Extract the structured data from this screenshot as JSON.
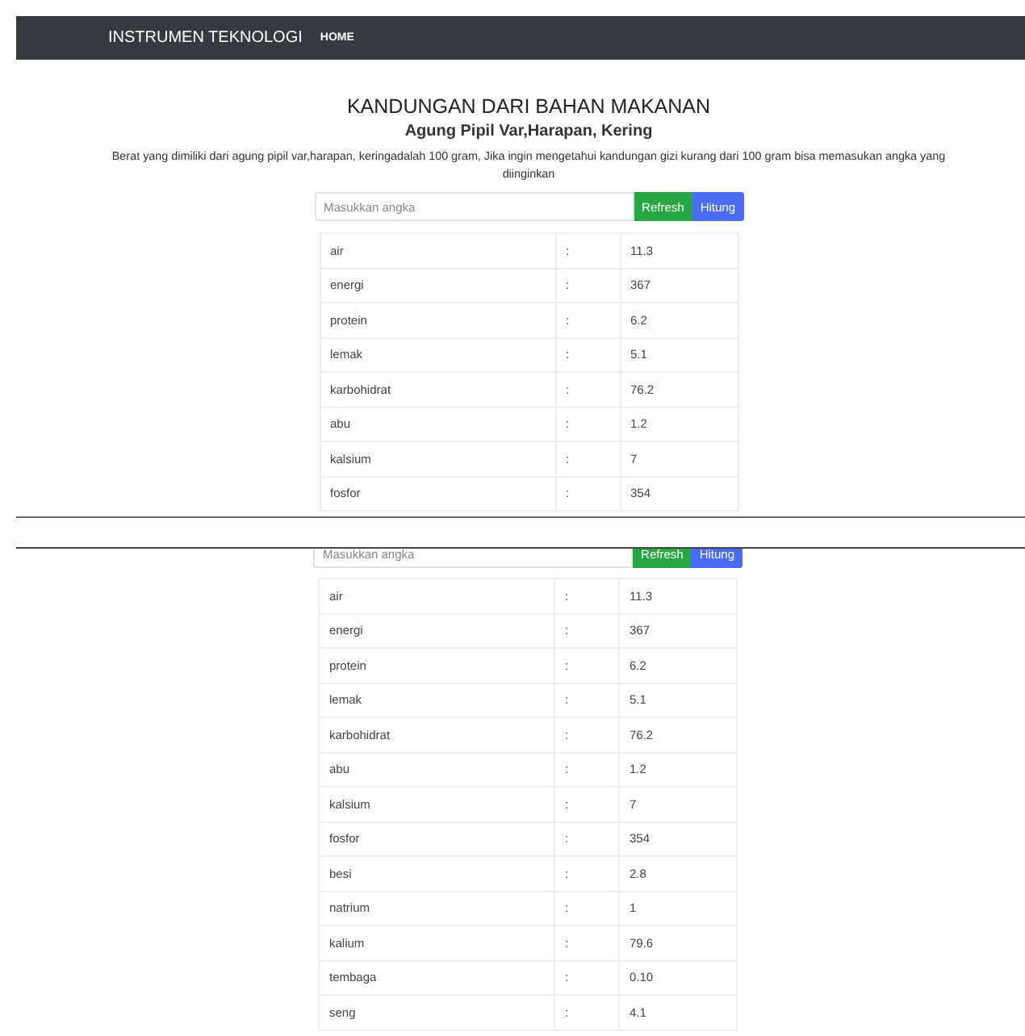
{
  "navbar": {
    "brand": "INSTRUMEN TEKNOLOGI",
    "links": [
      {
        "label": "HOME"
      }
    ]
  },
  "header": {
    "title": "KANDUNGAN DARI BAHAN MAKANAN",
    "subtitle": "Agung Pipil Var,Harapan, Kering",
    "description": "Berat yang dimiliki dari agung pipil var,harapan, keringadalah 100 gram, Jika ingin mengetahui kandungan gizi kurang dari 100 gram bisa memasukan angka yang diinginkan"
  },
  "panels": [
    {
      "input": {
        "placeholder": "Masukkan angka"
      },
      "buttons": [
        {
          "label": "Refresh",
          "kind": "success"
        },
        {
          "label": "Hitung",
          "kind": "primary"
        }
      ],
      "rows": [
        {
          "name": "air",
          "sep": ":",
          "value": "11.3"
        },
        {
          "name": "energi",
          "sep": ":",
          "value": "367"
        },
        {
          "name": "protein",
          "sep": ":",
          "value": "6.2"
        },
        {
          "name": "lemak",
          "sep": ":",
          "value": "5.1"
        },
        {
          "name": "karbohidrat",
          "sep": ":",
          "value": "76.2"
        },
        {
          "name": "abu",
          "sep": ":",
          "value": "1.2"
        },
        {
          "name": "kalsium",
          "sep": ":",
          "value": "7"
        },
        {
          "name": "fosfor",
          "sep": ":",
          "value": "354"
        }
      ]
    },
    {
      "input": {
        "placeholder": "Masukkan angka"
      },
      "buttons": [
        {
          "label": "Refresh",
          "kind": "success"
        },
        {
          "label": "Hitung",
          "kind": "primary"
        }
      ],
      "rows": [
        {
          "name": "air",
          "sep": ":",
          "value": "11.3"
        },
        {
          "name": "energi",
          "sep": ":",
          "value": "367"
        },
        {
          "name": "protein",
          "sep": ":",
          "value": "6.2"
        },
        {
          "name": "lemak",
          "sep": ":",
          "value": "5.1"
        },
        {
          "name": "karbohidrat",
          "sep": ":",
          "value": "76.2"
        },
        {
          "name": "abu",
          "sep": ":",
          "value": "1.2"
        },
        {
          "name": "kalsium",
          "sep": ":",
          "value": "7"
        },
        {
          "name": "fosfor",
          "sep": ":",
          "value": "354"
        },
        {
          "name": "besi",
          "sep": ":",
          "value": "2.8"
        },
        {
          "name": "natrium",
          "sep": ":",
          "value": "1"
        },
        {
          "name": "kalium",
          "sep": ":",
          "value": "79.6"
        },
        {
          "name": "tembaga",
          "sep": ":",
          "value": "0.10"
        },
        {
          "name": "seng",
          "sep": ":",
          "value": "4.1"
        }
      ]
    }
  ]
}
